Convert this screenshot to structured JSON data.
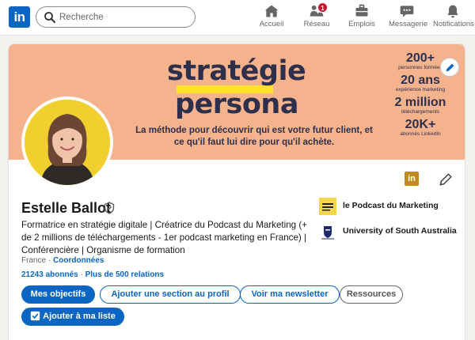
{
  "nav": {
    "logo": "in",
    "search_placeholder": "Recherche",
    "items": [
      {
        "label": "Accueil",
        "icon": "home-icon"
      },
      {
        "label": "Réseau",
        "icon": "network-icon",
        "badge": "1"
      },
      {
        "label": "Emplois",
        "icon": "briefcase-icon"
      },
      {
        "label": "Messagerie",
        "icon": "messaging-icon"
      },
      {
        "label": "Notifications",
        "icon": "bell-icon"
      }
    ]
  },
  "banner": {
    "title_line1": "stratégie",
    "title_line2": "persona",
    "tagline": "La méthode pour découvrir qui est votre futur client, et ce qu'il faut lui dire pour qu'il achète.",
    "stats": [
      {
        "value": "200+",
        "label": "personnes formées"
      },
      {
        "value": "20 ans",
        "label": "expérience marketing"
      },
      {
        "value": "2 million",
        "label": "téléchargements"
      },
      {
        "value": "20K+",
        "label": "abonnés LinkedIn"
      }
    ]
  },
  "profile": {
    "name": "Estelle Ballot",
    "headline": "Formatrice en stratégie digitale | Créatrice du Podcast du Marketing (+ de 2 millions de téléchargements - 1er podcast marketing en France) | Conférencière | Organisme de formation",
    "location": "France",
    "contact_link": "Coordonnées",
    "followers": "21243 abonnés",
    "connections": "Plus de 500 relations",
    "organizations": [
      {
        "name": "le Podcast du Marketing",
        "icon": "podcast-logo-icon"
      },
      {
        "name": "University of South Australia",
        "icon": "university-logo-icon"
      }
    ]
  },
  "actions": {
    "primary": "Mes objectifs",
    "add_section": "Ajouter une section au profil",
    "newsletter": "Voir ma newsletter",
    "resources": "Ressources",
    "add_list": "Ajouter à ma liste"
  },
  "colors": {
    "accent": "#0a66c2",
    "banner_bg": "#f4b28d",
    "banner_text": "#2e2f4a",
    "highlight": "#ffe32b",
    "avatar_bg": "#f1cf2e",
    "notification_badge": "#cb112d"
  }
}
